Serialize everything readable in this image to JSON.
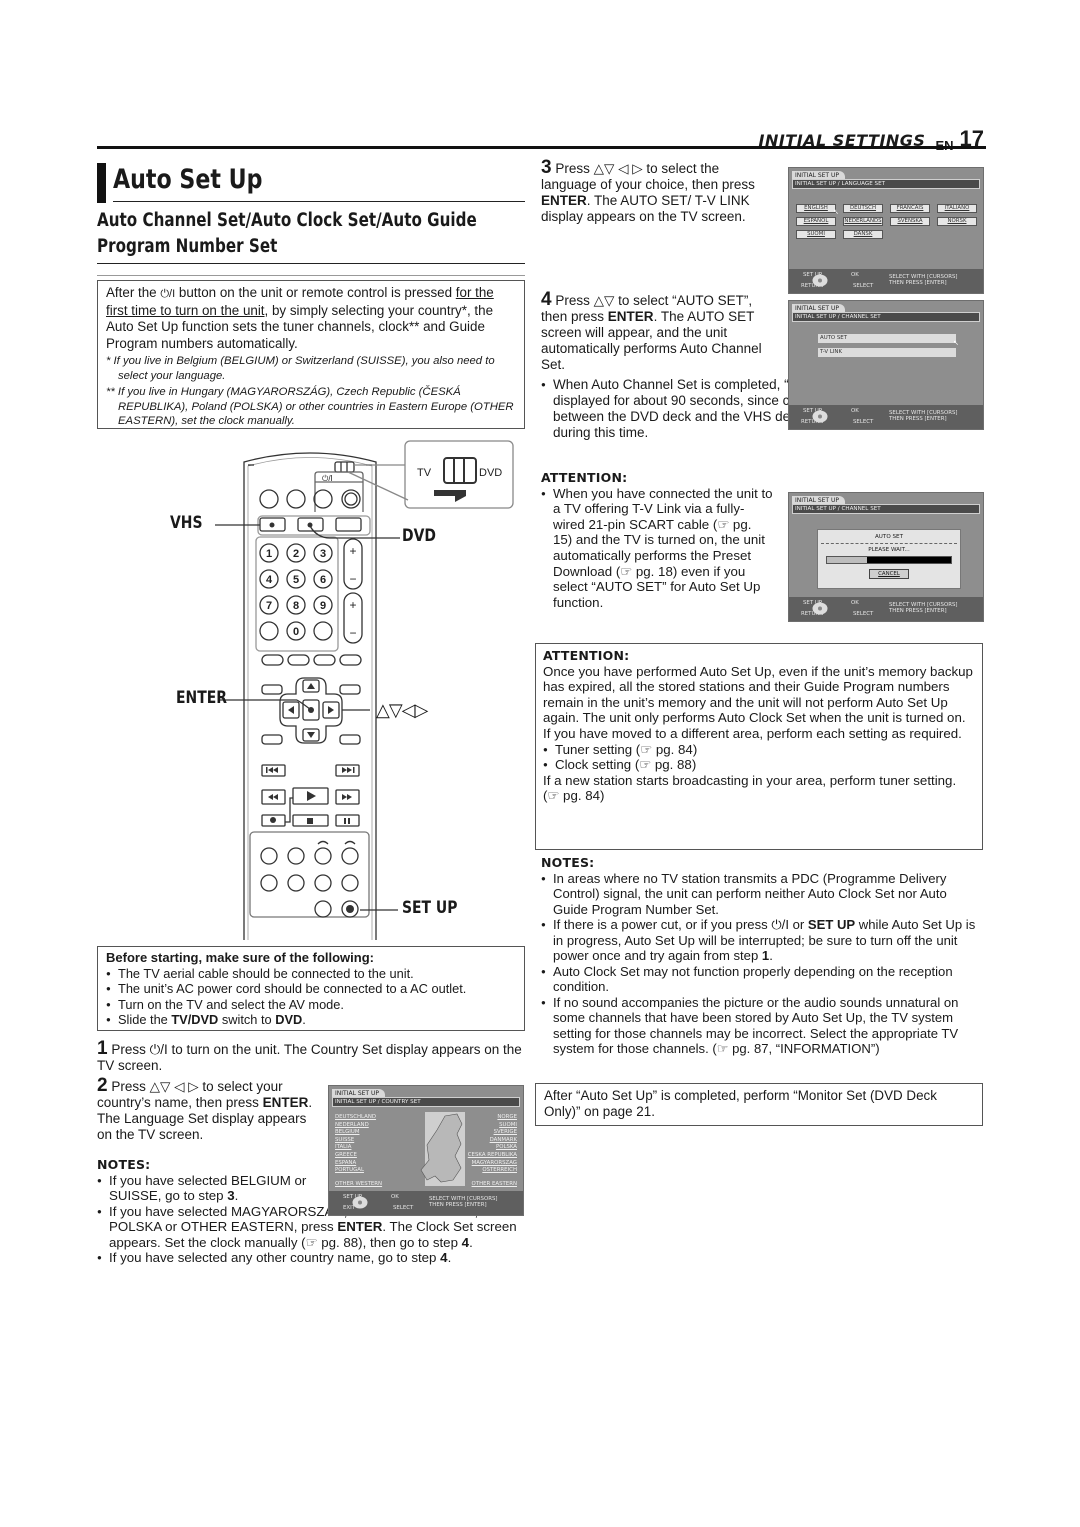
{
  "header": {
    "section": "INITIAL SETTINGS",
    "lang": "EN",
    "page_number": "17"
  },
  "title": "Auto Set Up",
  "subtitle": "Auto Channel Set/Auto Clock Set/Auto Guide Program Number Set",
  "intro": {
    "text_a": "After the ",
    "power_symbol": "⏻/I",
    "text_b": " button on the unit or remote control is pressed ",
    "underlined": "for the first time to turn on the unit",
    "text_c": ", by simply selecting your country*, the Auto Set Up function sets the tuner channels, clock** and Guide Program numbers automatically.",
    "footnotes": [
      "*  If you live in Belgium (BELGIUM) or Switzerland (SUISSE), you also need to select your language.",
      "** If you live in Hungary (MAGYARORSZÁG), Czech Republic (ČESKÁ REPUBLIKA), Poland (POLSKA) or other countries in Eastern Europe (OTHER EASTERN), set the clock manually."
    ]
  },
  "remote": {
    "callouts": {
      "vhs": "VHS",
      "dvd": "DVD",
      "enter": "ENTER",
      "arrows": "△▽◁▷",
      "set_up": "SET UP"
    },
    "switch_labels": {
      "left": "TV",
      "right": "DVD"
    },
    "power_label": "⏻/I",
    "number_keys": [
      "1",
      "2",
      "3",
      "4",
      "5",
      "6",
      "7",
      "8",
      "9",
      "0"
    ]
  },
  "before": {
    "heading": "Before starting, make sure of the following:",
    "items": [
      "The TV aerial cable should be connected to the unit.",
      "The unit’s AC power cord should be connected to a AC outlet.",
      "Turn on the TV and select the AV mode."
    ],
    "last_item": {
      "a": "Slide the ",
      "b1": "TV/DVD",
      "c": " switch to ",
      "b2": "DVD",
      "d": "."
    }
  },
  "step1": {
    "num": "1",
    "text": " Press ⏻/I to turn on the unit. The Country Set display appears on the TV screen."
  },
  "step2": {
    "num": "2",
    "text_a": " Press △▽ ◁ ▷ to select your country’s name, then press ",
    "bold": "ENTER",
    "text_b": ". The Language Set display appears on the TV screen."
  },
  "step2_notes": {
    "heading": "NOTES:",
    "note1": {
      "a": "If you have selected BELGIUM or SUISSE, go to step ",
      "b": "3",
      "c": "."
    },
    "note2": {
      "a": "If you have selected MAGYARORSZÁG, ČESKÁ REPUBLIKA, POLSKA or OTHER EASTERN, press ",
      "b": "ENTER",
      "c": ". The Clock Set screen appears. Set the clock manually (☞ pg. 88), then go to step ",
      "d": "4",
      "e": "."
    },
    "note3": {
      "a": "If you have selected any other country name, go to step ",
      "b": "4",
      "c": "."
    }
  },
  "step3": {
    "num": "3",
    "text_a": " Press △▽ ◁ ▷ to select the language of your choice, then press ",
    "bold": "ENTER",
    "text_b": ". The AUTO SET/ T-V LINK display appears on the TV screen."
  },
  "step4": {
    "num": "4",
    "text_a": " Press △▽ to select “AUTO SET”, then press ",
    "bold": "ENTER",
    "text_b": ". The AUTO SET screen will appear, and the unit automatically performs Auto Channel Set.",
    "bullet": "When Auto Channel Set is completed, “PLEASE WAIT” will be displayed for about 90 seconds, since channel data is exchanged between the DVD deck and the VHS deck. No operation will be done during this time."
  },
  "attention1": {
    "heading": "ATTENTION:",
    "text": "When you have connected the unit to a TV offering T-V Link via a fully-wired 21-pin SCART cable (☞ pg. 15) and the TV is turned on, the unit automatically performs the Preset Download (☞ pg. 18) even if you select “AUTO SET” for Auto Set Up function."
  },
  "attention2": {
    "heading": "ATTENTION:",
    "para1": "Once you have performed Auto Set Up, even if the unit’s memory backup has expired, all the stored stations and their Guide Program numbers remain in the unit’s memory and the unit will not perform Auto Set Up again. The unit only performs Auto Clock Set when the unit is turned on.",
    "para2": "If you have moved to a different area, perform each setting as required.",
    "items": [
      "Tuner setting (☞ pg. 84)",
      "Clock setting (☞ pg. 88)"
    ],
    "para3": "If a new station starts broadcasting in your area, perform tuner setting. (☞ pg. 84)"
  },
  "notes": {
    "heading": "NOTES:",
    "items": [
      {
        "a": "In areas where no TV station transmits a PDC (Programme Delivery Control) signal, the unit can perform neither Auto Clock Set nor Auto Guide Program Number Set."
      },
      {
        "a": "If there is a power cut, or if you press ⏻/I or ",
        "b": "SET UP",
        "c": " while Auto Set Up is in progress, Auto Set Up will be interrupted; be sure to turn off the unit power once and try again from step ",
        "d": "1",
        "e": "."
      },
      {
        "a": "Auto Clock Set may not function properly depending on the reception condition."
      },
      {
        "a": "If no sound accompanies the picture or the audio sounds unnatural on some channels that have been stored by Auto Set Up, the TV system setting for those channels may be incorrect. Select the appropriate TV system for those channels. (☞ pg. 87, “INFORMATION”)"
      }
    ]
  },
  "final_note": "After “Auto Set Up” is completed, perform “Monitor Set (DVD Deck Only)” on page 21.",
  "screens": {
    "country": {
      "tab": "INITIAL SET UP",
      "crumb": "INITIAL SET UP / COUNTRY SET",
      "left": [
        "DEUTSCHLAND",
        "NEDERLAND",
        "BELGIUM",
        "SUISSE",
        "ITALIA",
        "GREECE",
        "ESPANA",
        "PORTUGAL"
      ],
      "left_extra": "OTHER WESTERN",
      "right": [
        "NORGE",
        "SUOMI",
        "SVERIGE",
        "DANMARK",
        "POLSKA",
        "CESKA REPUBLIKA",
        "MAGYARORSZAG",
        "OSTERREICH"
      ],
      "right_extra": "OTHER EASTERN",
      "foot": {
        "setup": "SET UP",
        "ok": "OK",
        "back": "EXIT",
        "select": "SELECT",
        "hint1": "SELECT WITH [CURSORS]",
        "hint2": "THEN PRESS [ENTER]"
      }
    },
    "language": {
      "tab": "INITIAL SET UP",
      "crumb": "INITIAL SET UP / LANGUAGE SET",
      "options": [
        "ENGLISH",
        "DEUTSCH",
        "FRANCAIS",
        "ITALIANO",
        "ESPAÑOL",
        "NEDERLANDS",
        "SVENSKA",
        "NORSK",
        "SUOMI",
        "DANSK"
      ],
      "selected": "ENGLISH",
      "foot": {
        "setup": "SET UP",
        "ok": "OK",
        "back": "RETURN",
        "select": "SELECT",
        "hint1": "SELECT WITH [CURSORS]",
        "hint2": "THEN PRESS [ENTER]"
      }
    },
    "channel": {
      "tab": "INITIAL SET UP",
      "crumb": "INITIAL SET UP / CHANNEL SET",
      "options": [
        "AUTO SET",
        "T-V LINK"
      ],
      "selected": "AUTO SET",
      "foot": {
        "setup": "SET UP",
        "ok": "OK",
        "back": "RETURN",
        "select": "SELECT",
        "hint1": "SELECT WITH [CURSORS]",
        "hint2": "THEN PRESS [ENTER]"
      }
    },
    "autoset": {
      "tab": "INITIAL SET UP",
      "crumb": "INITIAL SET UP / CHANNEL SET",
      "dialog_title": "AUTO SET",
      "status": "PLEASE WAIT...",
      "progress_fraction": 0.32,
      "cancel": "CANCEL",
      "foot": {
        "setup": "SET UP",
        "ok": "OK",
        "back": "RETURN",
        "select": "SELECT",
        "hint1": "SELECT WITH [CURSORS]",
        "hint2": "THEN PRESS [ENTER]"
      }
    }
  }
}
